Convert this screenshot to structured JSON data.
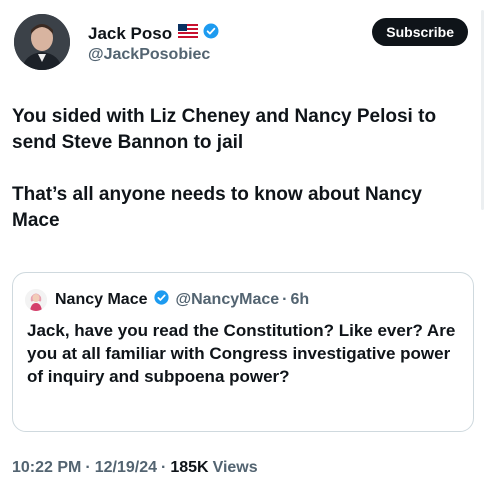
{
  "author": {
    "display_name": "Jack Poso",
    "handle": "@JackPosobiec",
    "flag_icon": "us-flag-icon",
    "verified_icon": "verified-badge-icon"
  },
  "subscribe_label": "Subscribe",
  "tweet": {
    "paragraphs": [
      "You sided with Liz Cheney and Nancy Pelosi to send Steve Bannon to jail",
      "That’s all anyone needs to know about Nancy Mace"
    ]
  },
  "quote": {
    "display_name": "Nancy Mace",
    "handle": "@NancyMace",
    "separator": "·",
    "time": "6h",
    "text": "Jack, have you read the Constitution? Like ever? Are you at all familiar with Congress investigative power of inquiry and subpoena power?"
  },
  "meta": {
    "time": "10:22 PM",
    "date": "12/19/24",
    "separator": "·",
    "views_count": "185K",
    "views_label": "Views"
  },
  "colors": {
    "text": "#0f1419",
    "secondary": "#536471",
    "verified": "#1d9bf0",
    "border": "#cfd9de"
  }
}
